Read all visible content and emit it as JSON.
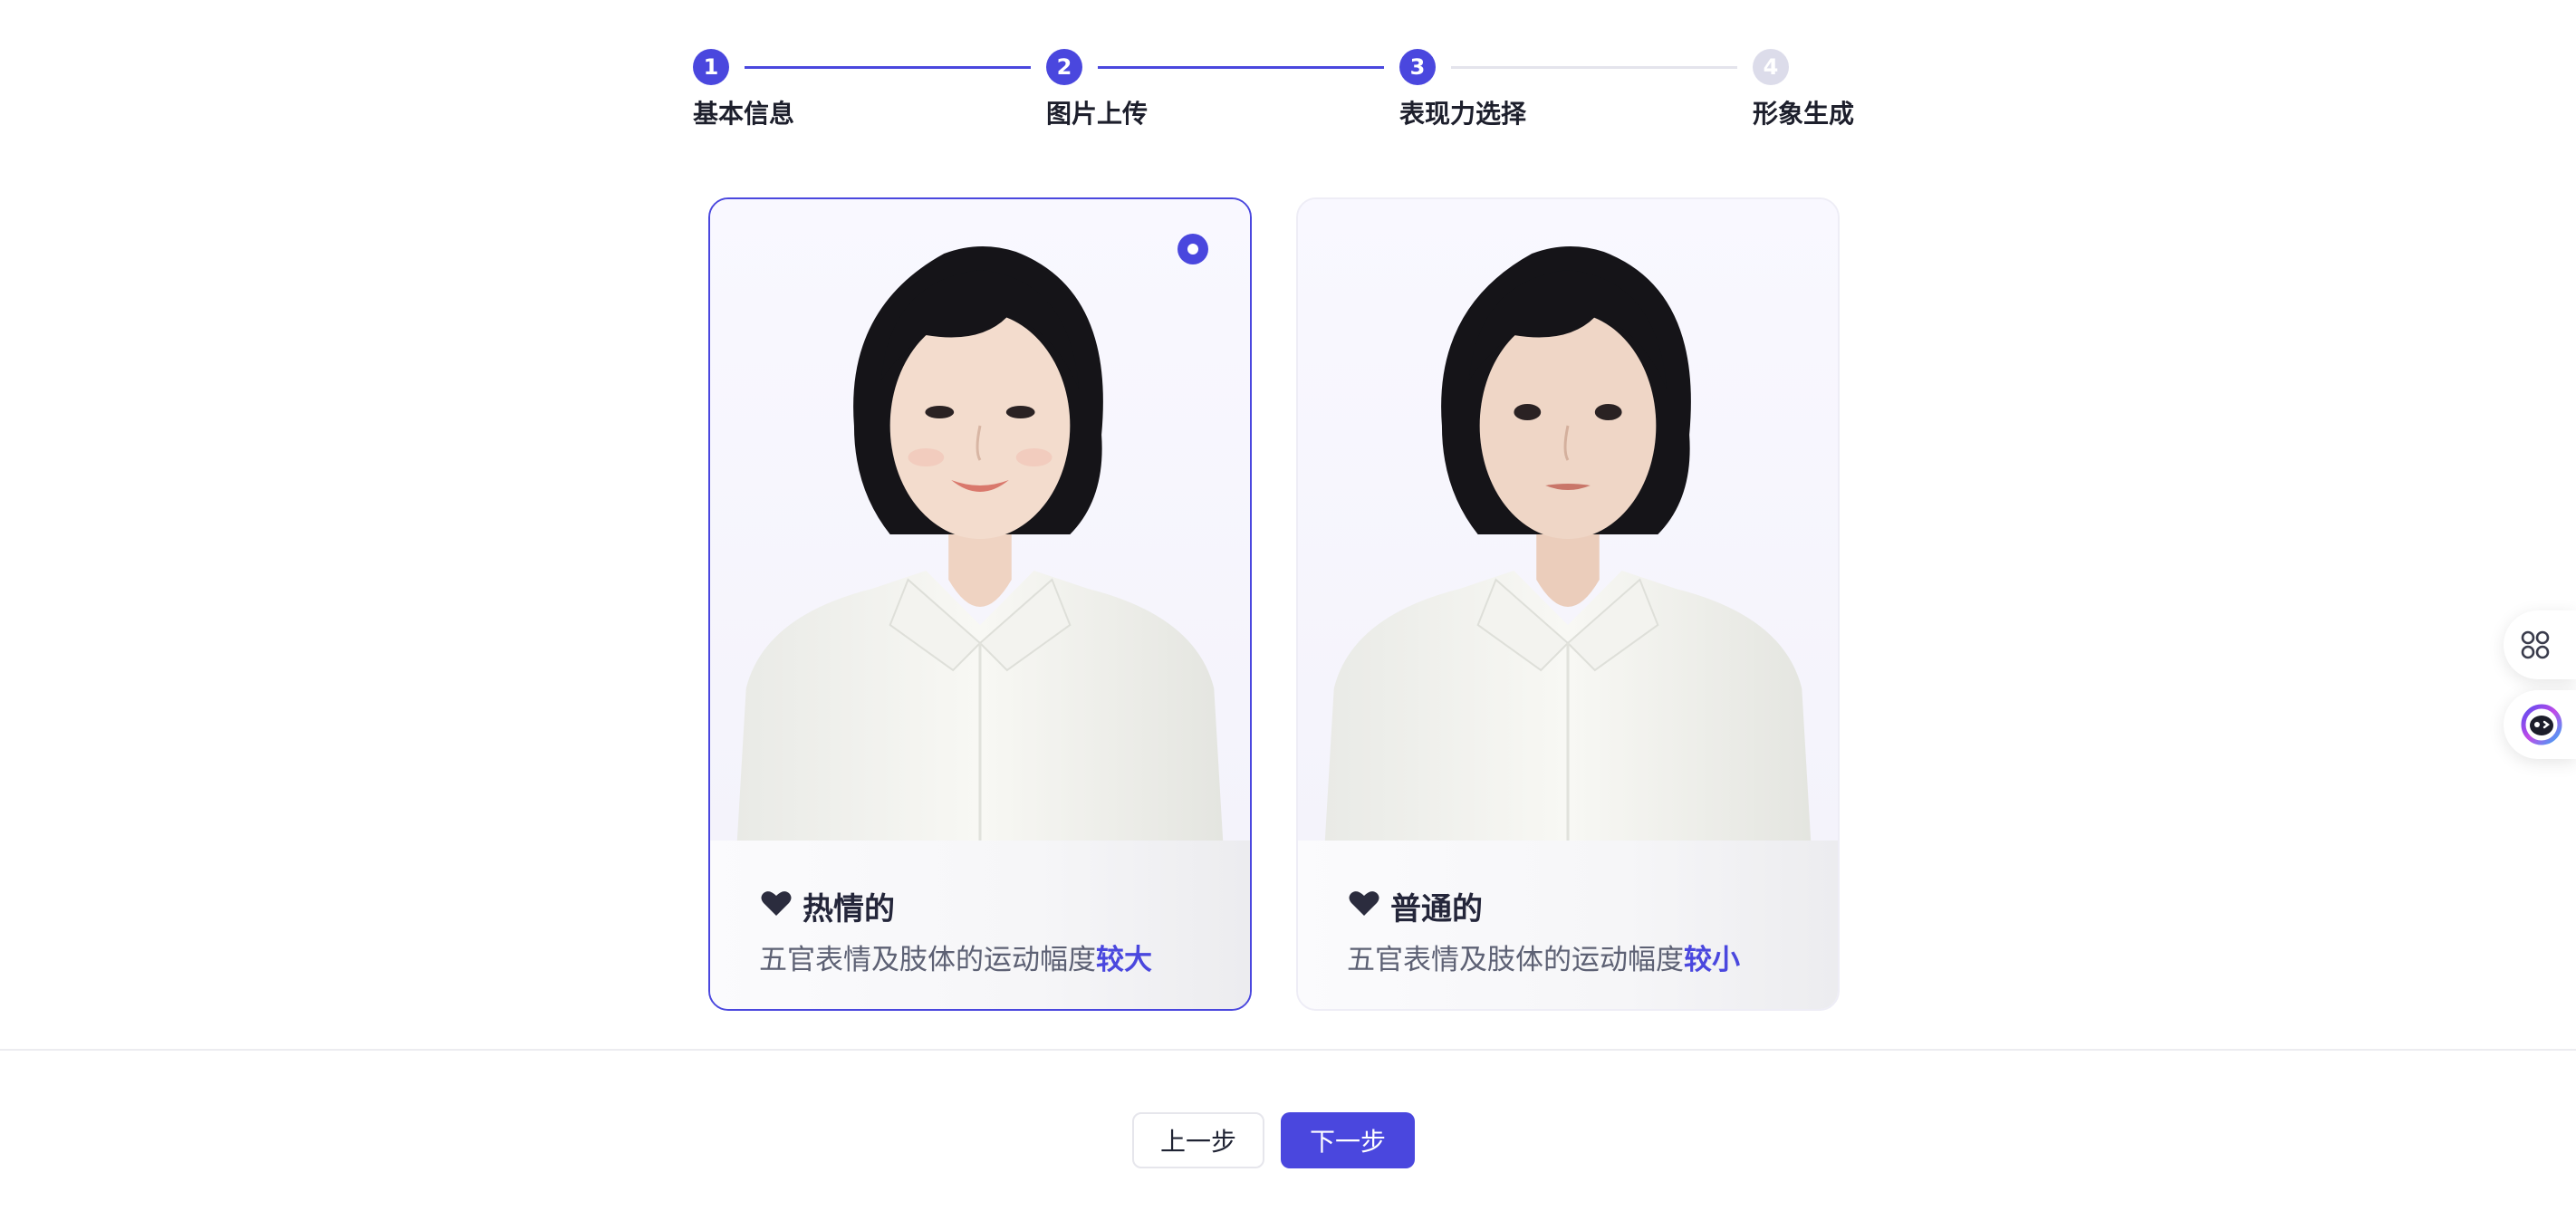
{
  "stepper": {
    "steps": [
      {
        "number": "1",
        "label": "基本信息",
        "state": "done"
      },
      {
        "number": "2",
        "label": "图片上传",
        "state": "done"
      },
      {
        "number": "3",
        "label": "表现力选择",
        "state": "current"
      },
      {
        "number": "4",
        "label": "形象生成",
        "state": "pending"
      }
    ]
  },
  "options": [
    {
      "title": "热情的",
      "desc_prefix": "五官表情及肢体的运动幅度",
      "desc_highlight": "较大",
      "selected": true,
      "icon": "heart-icon"
    },
    {
      "title": "普通的",
      "desc_prefix": "五官表情及肢体的运动幅度",
      "desc_highlight": "较小",
      "selected": false,
      "icon": "heart-icon"
    }
  ],
  "actions": {
    "prev_label": "上一步",
    "next_label": "下一步"
  },
  "side_buttons": [
    {
      "icon": "apps-grid-icon"
    },
    {
      "icon": "assistant-bot-icon"
    }
  ],
  "colors": {
    "accent": "#4a47de",
    "inactive_step": "#dcdcea",
    "text": "#1d1f2c",
    "muted_text": "#5d6174"
  }
}
